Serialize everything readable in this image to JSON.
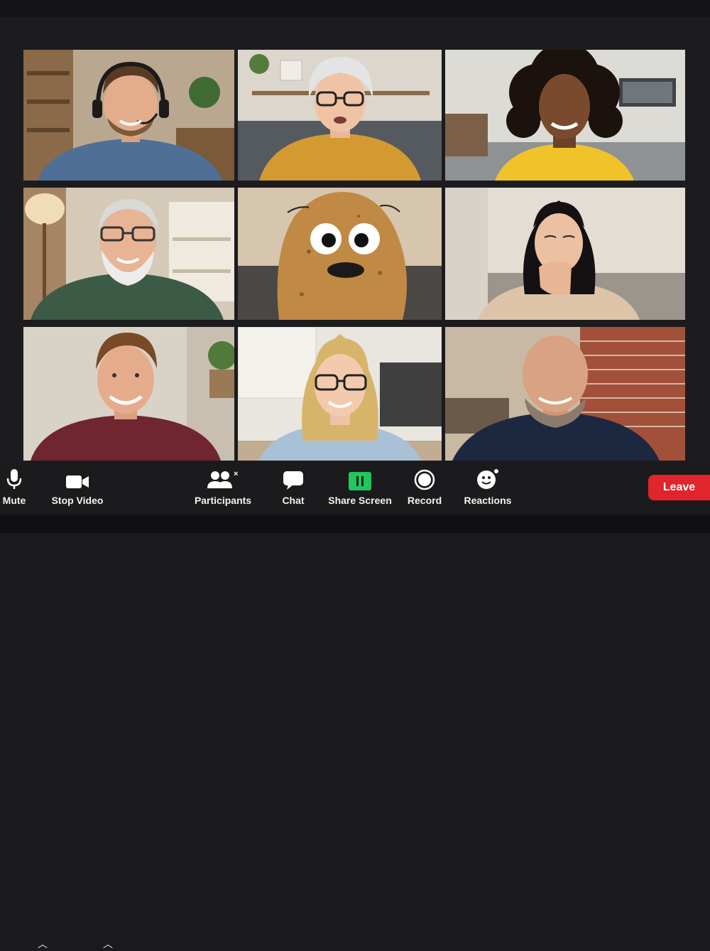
{
  "toolbar": {
    "mute_label": "Mute",
    "stop_video_label": "Stop Video",
    "participants_label": "Participants",
    "chat_label": "Chat",
    "share_screen_label": "Share Screen",
    "record_label": "Record",
    "reactions_label": "Reactions",
    "leave_label": "Leave"
  },
  "colors": {
    "leave_button": "#e0252b",
    "share_screen_icon": "#22c55e",
    "background": "#1a1a1d"
  },
  "icons": {
    "mute": "microphone-icon",
    "video": "video-camera-icon",
    "participants": "people-icon",
    "chat": "speech-bubble-icon",
    "share_screen": "share-screen-icon",
    "record": "record-icon",
    "reactions": "smiley-icon"
  }
}
